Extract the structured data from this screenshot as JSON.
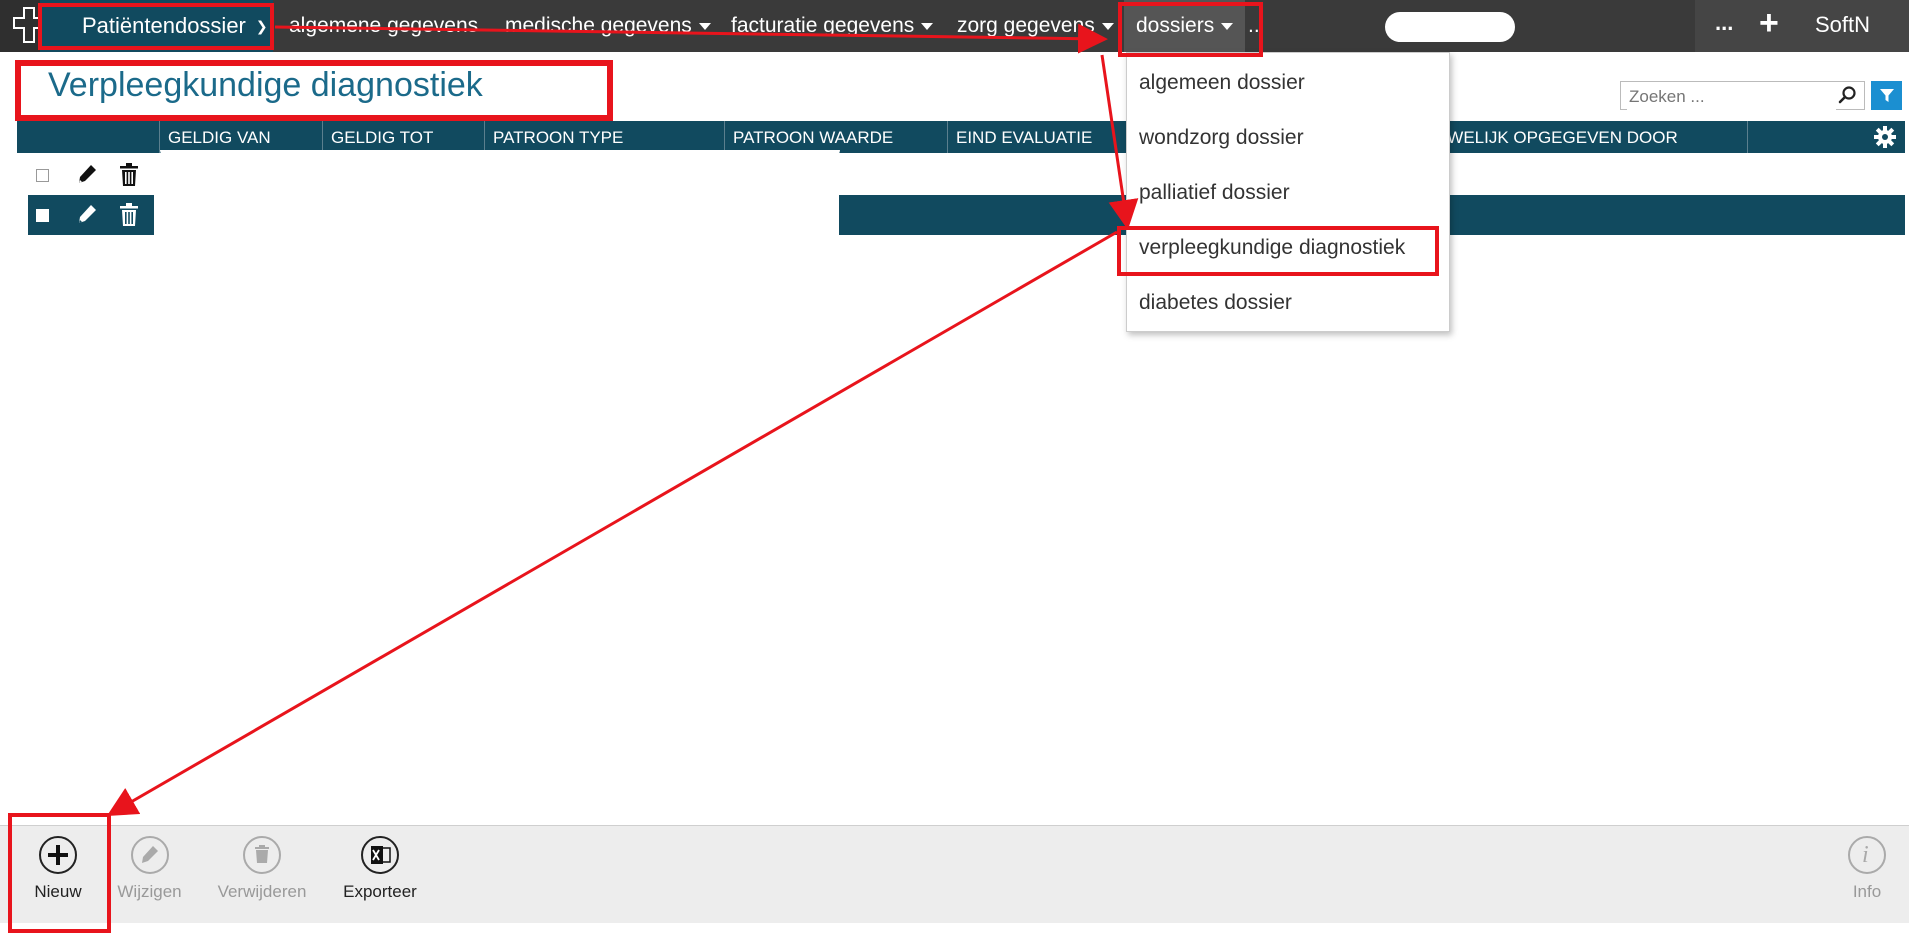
{
  "topbar": {
    "app_menu_label": "Patiëntendossier",
    "nav": [
      {
        "label": "algemene gegevens"
      },
      {
        "label": "medische gegevens"
      },
      {
        "label": "facturatie gegevens"
      },
      {
        "label": "zorg gegevens"
      },
      {
        "label": "dossiers"
      },
      {
        "label": ".."
      }
    ],
    "more_label": "...",
    "plus_label": "+",
    "user_label": "SoftN"
  },
  "page": {
    "title": "Verpleegkundige diagnostiek",
    "search_placeholder": "Zoeken ..."
  },
  "grid": {
    "columns": [
      "GELDIG VAN",
      "GELDIG TOT",
      "PATROON TYPE",
      "PATROON WAARDE",
      "EIND EVALUATIE",
      "UWELIJK OPGEGEVEN DOOR"
    ],
    "rows": [
      {
        "selected": false
      },
      {
        "selected": true
      }
    ]
  },
  "dropdown": {
    "items": [
      "algemeen dossier",
      "wondzorg dossier",
      "palliatief dossier",
      "verpleegkundige diagnostiek",
      "diabetes dossier"
    ],
    "highlighted_index": 3
  },
  "toolbar": {
    "new_label": "Nieuw",
    "edit_label": "Wijzigen",
    "delete_label": "Verwijderen",
    "export_label": "Exporteer",
    "info_label": "Info"
  },
  "colors": {
    "primary": "#114a5f",
    "title": "#1b6a8a",
    "annotation": "#e8141c",
    "filter": "#1b8fd1"
  }
}
